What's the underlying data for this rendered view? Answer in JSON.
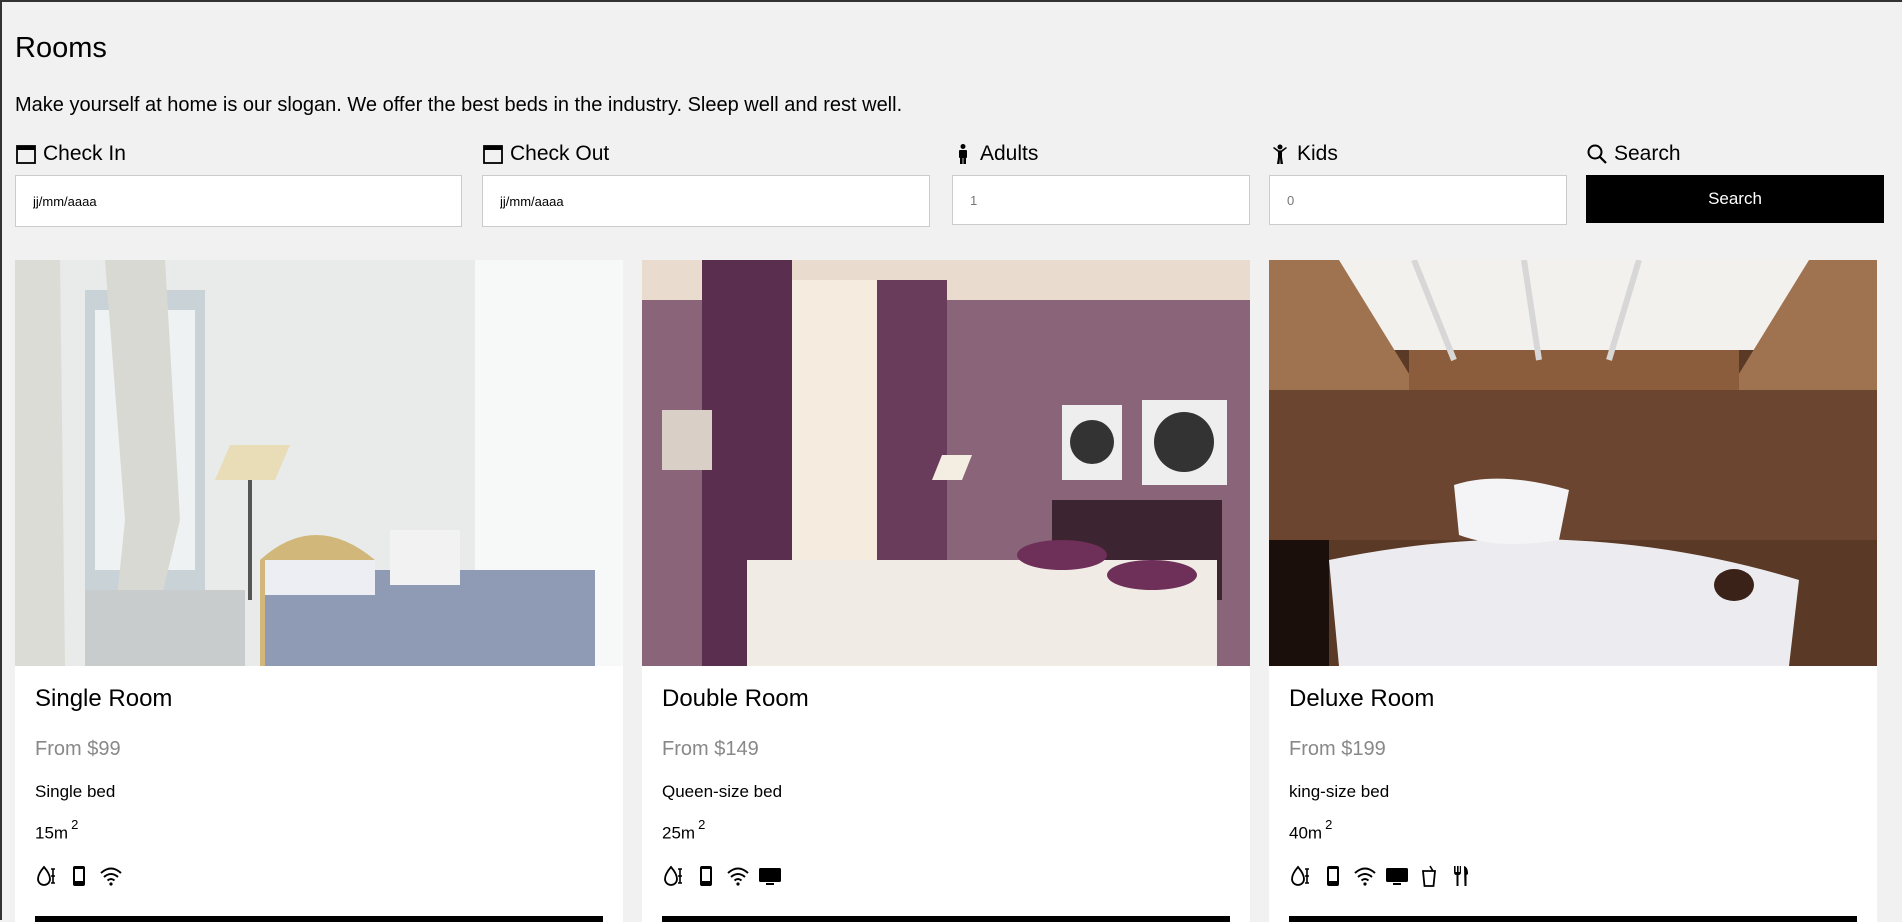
{
  "page": {
    "title": "Rooms",
    "slogan": "Make yourself at home is our slogan. We offer the best beds in the industry. Sleep well and rest well."
  },
  "search_form": {
    "check_in": {
      "label": "Check In",
      "value": "jj/mm/aaaa",
      "icon": "calendar-icon"
    },
    "check_out": {
      "label": "Check Out",
      "value": "jj/mm/aaaa",
      "icon": "calendar-icon"
    },
    "adults": {
      "label": "Adults",
      "value": "1",
      "icon": "adult-icon"
    },
    "kids": {
      "label": "Kids",
      "value": "0",
      "icon": "child-icon"
    },
    "search": {
      "label": "Search",
      "button_label": "Search",
      "icon": "search-icon"
    }
  },
  "rooms": [
    {
      "name": "Single Room",
      "price": "From $99",
      "bed": "Single bed",
      "size": "15m",
      "size_sup": "2",
      "amenities": [
        "hair-dryer-icon",
        "phone-icon",
        "wifi-icon"
      ]
    },
    {
      "name": "Double Room",
      "price": "From $149",
      "bed": "Queen-size bed",
      "size": "25m",
      "size_sup": "2",
      "amenities": [
        "hair-dryer-icon",
        "phone-icon",
        "wifi-icon",
        "tv-icon"
      ]
    },
    {
      "name": "Deluxe Room",
      "price": "From $199",
      "bed": "king-size bed",
      "size": "40m",
      "size_sup": "2",
      "amenities": [
        "hair-dryer-icon",
        "phone-icon",
        "wifi-icon",
        "tv-icon",
        "drink-icon",
        "restaurant-icon"
      ]
    }
  ],
  "colors": {
    "background": "#f1f1f1",
    "button": "#000000",
    "price": "#888888"
  }
}
